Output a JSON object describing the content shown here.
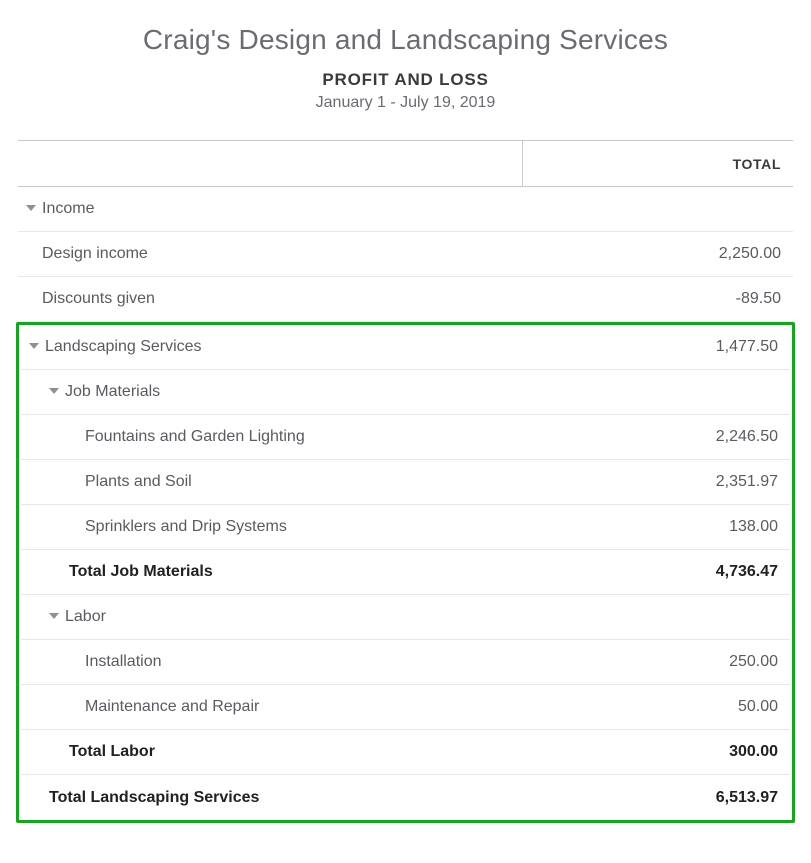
{
  "header": {
    "company": "Craig's Design and Landscaping Services",
    "report_title": "PROFIT AND LOSS",
    "date_range": "January 1 - July 19, 2019"
  },
  "columns": {
    "total": "TOTAL"
  },
  "rows": {
    "income": {
      "label": "Income"
    },
    "design_income": {
      "label": "Design income",
      "value": "2,250.00"
    },
    "discounts_given": {
      "label": "Discounts given",
      "value": "-89.50"
    },
    "landscaping_services": {
      "label": "Landscaping Services",
      "value": "1,477.50"
    },
    "job_materials": {
      "label": "Job Materials"
    },
    "fountains": {
      "label": "Fountains and Garden Lighting",
      "value": "2,246.50"
    },
    "plants": {
      "label": "Plants and Soil",
      "value": "2,351.97"
    },
    "sprinklers": {
      "label": "Sprinklers and Drip Systems",
      "value": "138.00"
    },
    "total_job_materials": {
      "label": "Total Job Materials",
      "value": "4,736.47"
    },
    "labor": {
      "label": "Labor"
    },
    "installation": {
      "label": "Installation",
      "value": "250.00"
    },
    "maintenance": {
      "label": "Maintenance and Repair",
      "value": "50.00"
    },
    "total_labor": {
      "label": "Total Labor",
      "value": "300.00"
    },
    "total_landscaping": {
      "label": "Total Landscaping Services",
      "value": "6,513.97"
    }
  }
}
